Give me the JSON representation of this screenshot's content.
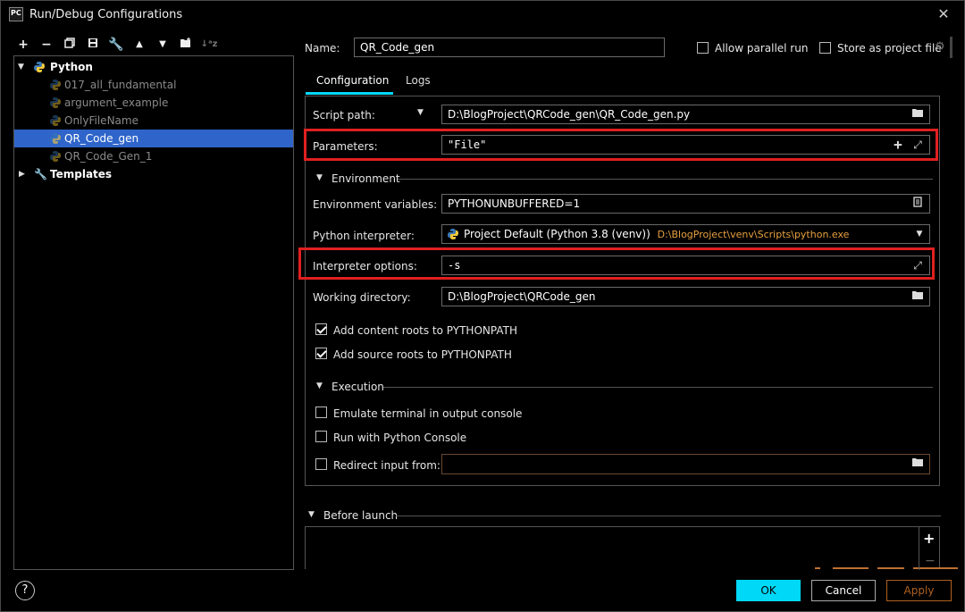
{
  "window": {
    "title": "Run/Debug Configurations",
    "app_icon": "PC"
  },
  "toolbar": {
    "icons": [
      "plus-icon",
      "minus-icon",
      "copy-icon",
      "save-icon",
      "wrench-icon",
      "arrow-up-icon",
      "arrow-down-icon",
      "new-folder-icon",
      "sort-icon"
    ]
  },
  "tree": {
    "python_label": "Python",
    "items": [
      {
        "label": "017_all_fundamental"
      },
      {
        "label": "argument_example"
      },
      {
        "label": "OnlyFileName"
      },
      {
        "label": "QR_Code_gen"
      },
      {
        "label": "QR_Code_Gen_1"
      }
    ],
    "templates_label": "Templates"
  },
  "header": {
    "name_label": "Name:",
    "name_value": "QR_Code_gen",
    "allow_parallel": "Allow parallel run",
    "store_project": "Store as project file"
  },
  "tabs": [
    {
      "label": "Configuration"
    },
    {
      "label": "Logs"
    }
  ],
  "config": {
    "script_path_label": "Script path:",
    "script_path_value": "D:\\BlogProject\\QRCode_gen\\QR_Code_gen.py",
    "parameters_label": "Parameters:",
    "parameters_value": "\"File\"",
    "environment_label": "Environment",
    "env_vars_label": "Environment variables:",
    "env_vars_value": "PYTHONUNBUFFERED=1",
    "interpreter_label": "Python interpreter:",
    "interpreter_value": "Project Default (Python 3.8 (venv))",
    "interpreter_path": "D:\\BlogProject\\venv\\Scripts\\python.exe",
    "interp_options_label": "Interpreter options:",
    "interp_options_value": "-s",
    "working_dir_label": "Working directory:",
    "working_dir_value": "D:\\BlogProject\\QRCode_gen",
    "add_content_roots": "Add content roots to PYTHONPATH",
    "add_source_roots": "Add source roots to PYTHONPATH",
    "execution_label": "Execution",
    "emulate_terminal": "Emulate terminal in output console",
    "run_console": "Run with Python Console",
    "redirect_input": "Redirect input from:"
  },
  "before_launch": {
    "label": "Before launch"
  },
  "buttons": {
    "ok": "OK",
    "cancel": "Cancel",
    "apply": "Apply",
    "help": "?"
  },
  "colors": {
    "accent": "#00d8f8",
    "selection": "#2f65ca",
    "highlight": "#e02020",
    "apply_border": "#b06020"
  }
}
